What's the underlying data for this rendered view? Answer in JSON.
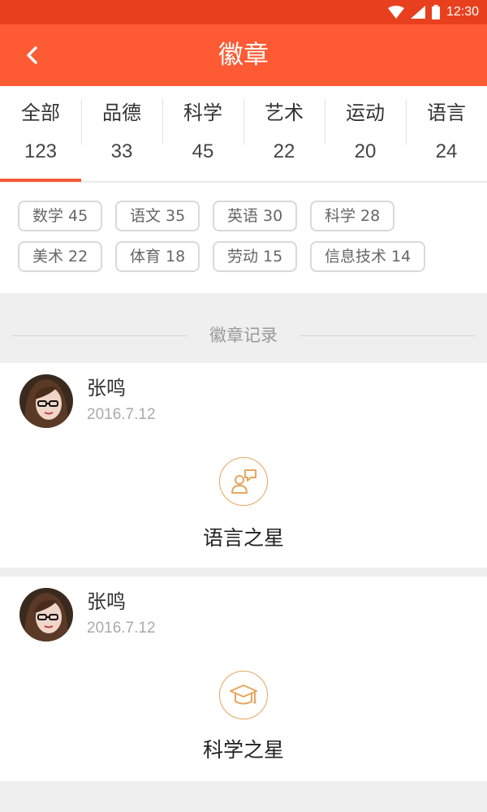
{
  "status_bar": {
    "time": "12:30"
  },
  "header": {
    "title": "徽章",
    "back_icon": "chevron-left-icon"
  },
  "tabs": [
    {
      "label": "全部",
      "count": "123",
      "active": true
    },
    {
      "label": "品德",
      "count": "33"
    },
    {
      "label": "科学",
      "count": "45"
    },
    {
      "label": "艺术",
      "count": "22"
    },
    {
      "label": "运动",
      "count": "20"
    },
    {
      "label": "语言",
      "count": "24"
    }
  ],
  "chips": [
    {
      "label": "数学 45"
    },
    {
      "label": "语文 35"
    },
    {
      "label": "英语 30"
    },
    {
      "label": "科学 28"
    },
    {
      "label": "美术 22"
    },
    {
      "label": "体育 18"
    },
    {
      "label": "劳动 15"
    },
    {
      "label": "信息技术 14"
    }
  ],
  "section": {
    "title": "徽章记录"
  },
  "records": [
    {
      "user": "张鸣",
      "date": "2016.7.12",
      "badge_name": "语言之星",
      "badge_icon": "speaking-person-icon"
    },
    {
      "user": "张鸣",
      "date": "2016.7.12",
      "badge_name": "科学之星",
      "badge_icon": "graduation-cap-icon"
    }
  ],
  "colors": {
    "header": "#fe5a33",
    "status_bar": "#e8401f",
    "accent": "#f25a35",
    "badge": "#e5a55f"
  }
}
